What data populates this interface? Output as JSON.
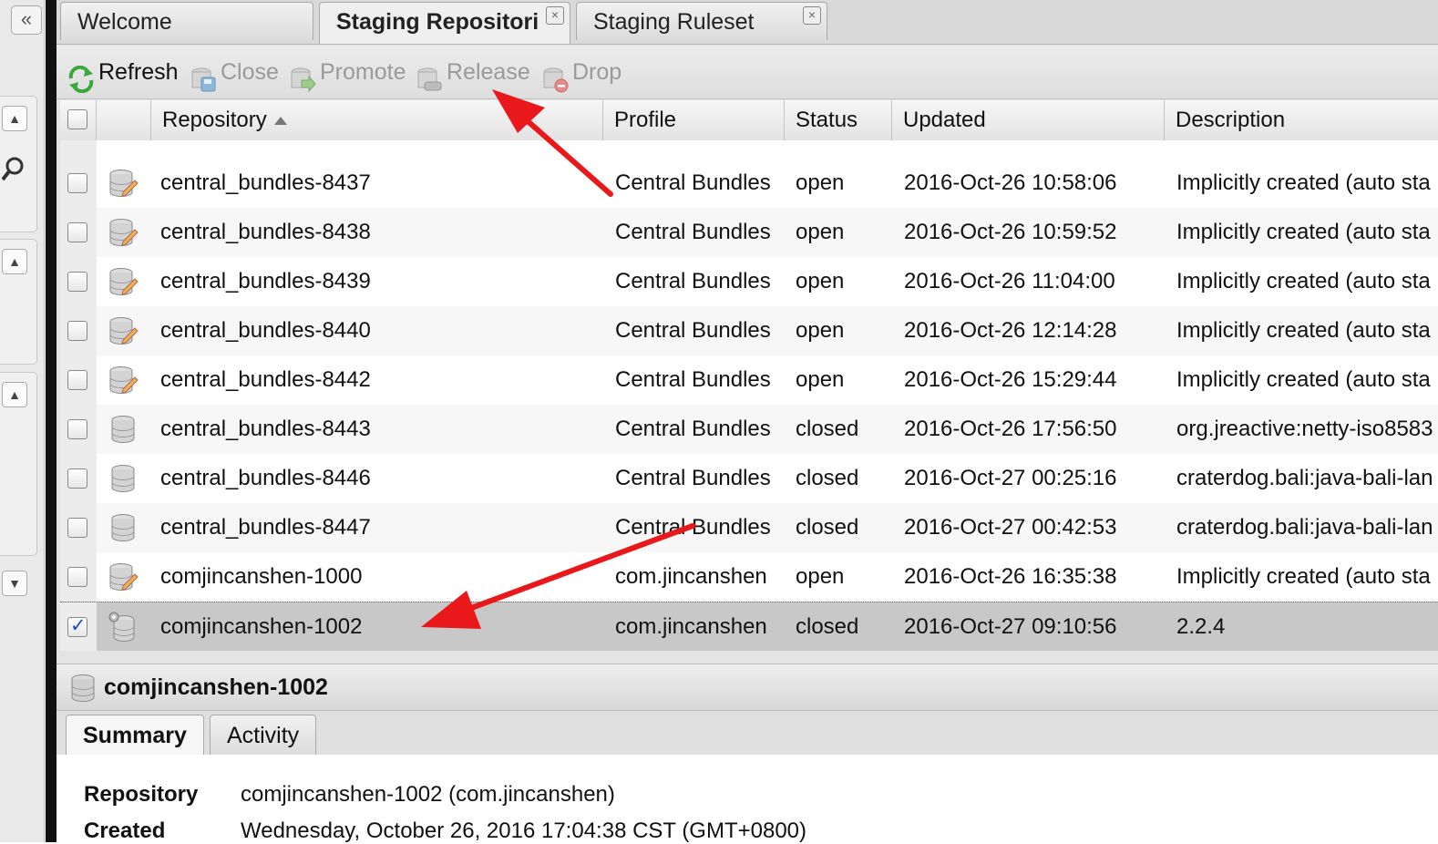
{
  "tabs": [
    {
      "label": "Welcome"
    },
    {
      "label": "Staging Repositori"
    },
    {
      "label": "Staging Ruleset"
    }
  ],
  "toolbar": {
    "refresh": "Refresh",
    "close": "Close",
    "promote": "Promote",
    "release": "Release",
    "drop": "Drop"
  },
  "grid": {
    "columns": {
      "repository": "Repository",
      "profile": "Profile",
      "status": "Status",
      "updated": "Updated",
      "description": "Description"
    },
    "rows": [
      {
        "repository": "central_bundles-8437",
        "profile": "Central Bundles",
        "status": "open",
        "updated": "2016-Oct-26 10:58:06",
        "description": "Implicitly created (auto sta",
        "icon": "edit-repo-icon",
        "checked": false
      },
      {
        "repository": "central_bundles-8438",
        "profile": "Central Bundles",
        "status": "open",
        "updated": "2016-Oct-26 10:59:52",
        "description": "Implicitly created (auto sta",
        "icon": "edit-repo-icon",
        "checked": false
      },
      {
        "repository": "central_bundles-8439",
        "profile": "Central Bundles",
        "status": "open",
        "updated": "2016-Oct-26 11:04:00",
        "description": "Implicitly created (auto sta",
        "icon": "edit-repo-icon",
        "checked": false
      },
      {
        "repository": "central_bundles-8440",
        "profile": "Central Bundles",
        "status": "open",
        "updated": "2016-Oct-26 12:14:28",
        "description": "Implicitly created (auto sta",
        "icon": "edit-repo-icon",
        "checked": false
      },
      {
        "repository": "central_bundles-8442",
        "profile": "Central Bundles",
        "status": "open",
        "updated": "2016-Oct-26 15:29:44",
        "description": "Implicitly created (auto sta",
        "icon": "edit-repo-icon",
        "checked": false
      },
      {
        "repository": "central_bundles-8443",
        "profile": "Central Bundles",
        "status": "closed",
        "updated": "2016-Oct-26 17:56:50",
        "description": "org.jreactive:netty-iso8583",
        "icon": "database-icon",
        "checked": false
      },
      {
        "repository": "central_bundles-8446",
        "profile": "Central Bundles",
        "status": "closed",
        "updated": "2016-Oct-27 00:25:16",
        "description": "craterdog.bali:java-bali-lan",
        "icon": "database-icon",
        "checked": false
      },
      {
        "repository": "central_bundles-8447",
        "profile": "Central Bundles",
        "status": "closed",
        "updated": "2016-Oct-27 00:42:53",
        "description": "craterdog.bali:java-bali-lan",
        "icon": "database-icon",
        "checked": false
      },
      {
        "repository": "comjincanshen-1000",
        "profile": "com.jincanshen",
        "status": "open",
        "updated": "2016-Oct-26 16:35:38",
        "description": "Implicitly created (auto sta",
        "icon": "edit-repo-icon",
        "checked": false
      },
      {
        "repository": "comjincanshen-1002",
        "profile": "com.jincanshen",
        "status": "closed",
        "updated": "2016-Oct-27 09:10:56",
        "description": "2.2.4",
        "icon": "database-busy-icon",
        "checked": true
      }
    ]
  },
  "detail": {
    "title": "comjincanshen-1002",
    "tabs": {
      "summary": "Summary",
      "activity": "Activity"
    },
    "fields": {
      "repository_label": "Repository",
      "repository_value": "comjincanshen-1002 (com.jincanshen)",
      "created_label": "Created",
      "created_value": "Wednesday, October 26, 2016 17:04:38 CST (GMT+0800)"
    }
  },
  "colors": {
    "annotation_arrow": "#e8181b",
    "selected_row": "#c8c8c8",
    "refresh_icon": "#3aa83a"
  }
}
